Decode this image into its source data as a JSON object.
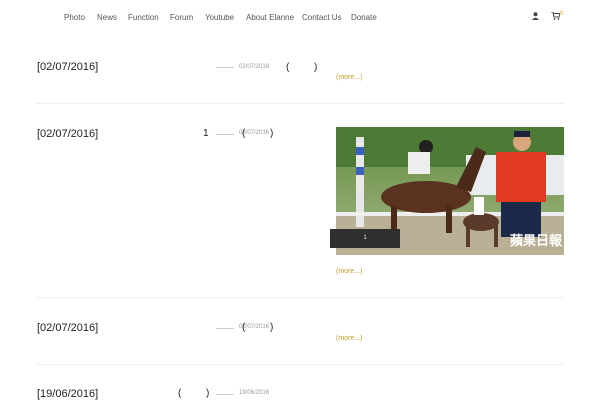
{
  "nav": {
    "items": [
      "Photo",
      "News",
      "Function",
      "Forum",
      "Youtube",
      "About Elanne",
      "Contact Us",
      "Donate"
    ],
    "user_icon": "user-icon",
    "cart_icon": "cart-icon",
    "cart_count": "0"
  },
  "posts": [
    {
      "date": "[02/07/2016]",
      "small_date": "02/07/2016",
      "paren_open": "(",
      "paren_close": ")",
      "more": "(more...)"
    },
    {
      "date": "[02/07/2016]",
      "number": "1",
      "small_date": "02/07/2016",
      "paren_open": "(",
      "paren_close": ")",
      "more": "(more...)",
      "caption": "1",
      "image_text": "蘋果日報"
    },
    {
      "date": "[02/07/2016]",
      "small_date": "02/07/2016",
      "paren_open": "(",
      "paren_close": ")",
      "more": "(more...)"
    },
    {
      "date": "[19/06/2016]",
      "small_date": "19/06/2016",
      "paren_open": "(",
      "paren_close": ")"
    }
  ],
  "colors": {
    "accent": "#c59a24",
    "caption_bg": "#2f2f2f"
  }
}
